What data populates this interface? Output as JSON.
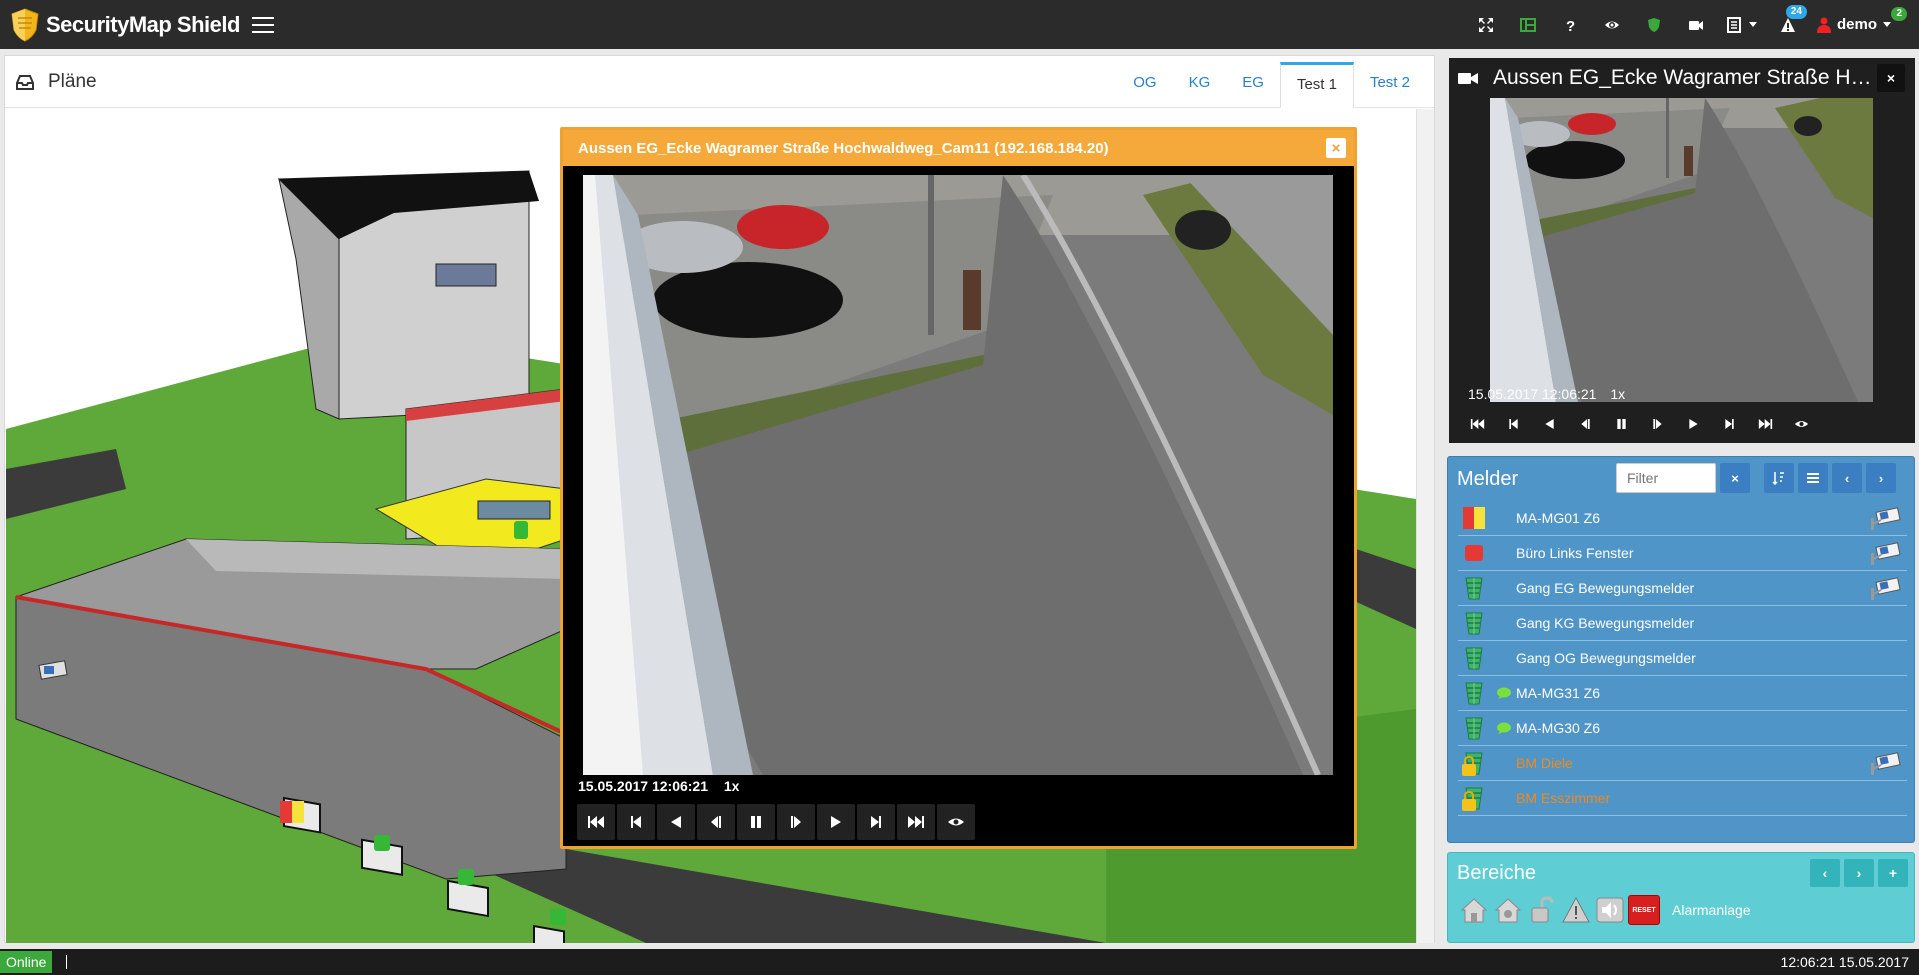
{
  "app": {
    "title": "SecurityMap Shield"
  },
  "topbar": {
    "badge_alerts": "24",
    "badge_shield": "2",
    "user": "demo"
  },
  "plans": {
    "title": "Pläne",
    "tabs": [
      {
        "label": "OG"
      },
      {
        "label": "KG"
      },
      {
        "label": "EG"
      },
      {
        "label": "Test 1",
        "active": true
      },
      {
        "label": "Test 2"
      }
    ]
  },
  "popup": {
    "title": "Aussen EG_Ecke Wagramer Straße Hochwaldweg_Cam11 (192.168.184.20)",
    "timestamp": "15.05.2017 12:06:21",
    "speed": "1x"
  },
  "rightcam": {
    "title": "Aussen EG_Ecke Wagramer Straße Ho...",
    "timestamp": "15.05.2017 12:06:21",
    "speed": "1x"
  },
  "melder": {
    "title": "Melder",
    "filter_placeholder": "Filter",
    "items": [
      {
        "label": "MA-MG01 Z6",
        "state": "red-yellow",
        "camera": true,
        "message": false,
        "color": "white"
      },
      {
        "label": "Büro Links Fenster",
        "state": "red",
        "camera": true,
        "message": false,
        "color": "white"
      },
      {
        "label": "Gang EG Bewegungsmelder",
        "state": "green",
        "camera": true,
        "message": false,
        "color": "white"
      },
      {
        "label": "Gang KG Bewegungsmelder",
        "state": "green",
        "camera": false,
        "message": false,
        "color": "white"
      },
      {
        "label": "Gang OG Bewegungsmelder",
        "state": "green",
        "camera": false,
        "message": false,
        "color": "white"
      },
      {
        "label": "MA-MG31 Z6",
        "state": "green",
        "camera": false,
        "message": true,
        "color": "white"
      },
      {
        "label": "MA-MG30 Z6",
        "state": "green",
        "camera": false,
        "message": true,
        "color": "white"
      },
      {
        "label": "BM Diele",
        "state": "locked",
        "camera": true,
        "message": false,
        "color": "orange"
      },
      {
        "label": "BM Esszimmer",
        "state": "locked",
        "camera": false,
        "message": false,
        "color": "orange"
      }
    ]
  },
  "bereiche": {
    "title": "Bereiche",
    "reset_label": "RESET",
    "alarm_label": "Alarmanlage"
  },
  "status": {
    "online": "Online",
    "clock": "12:06:21 15.05.2017"
  },
  "colors": {
    "accent": "#2ea8e6",
    "popup_header": "#f5a93a",
    "melder_bg": "#4f95c8",
    "bereiche_bg": "#5ecdd4",
    "online": "#3aa83a"
  }
}
